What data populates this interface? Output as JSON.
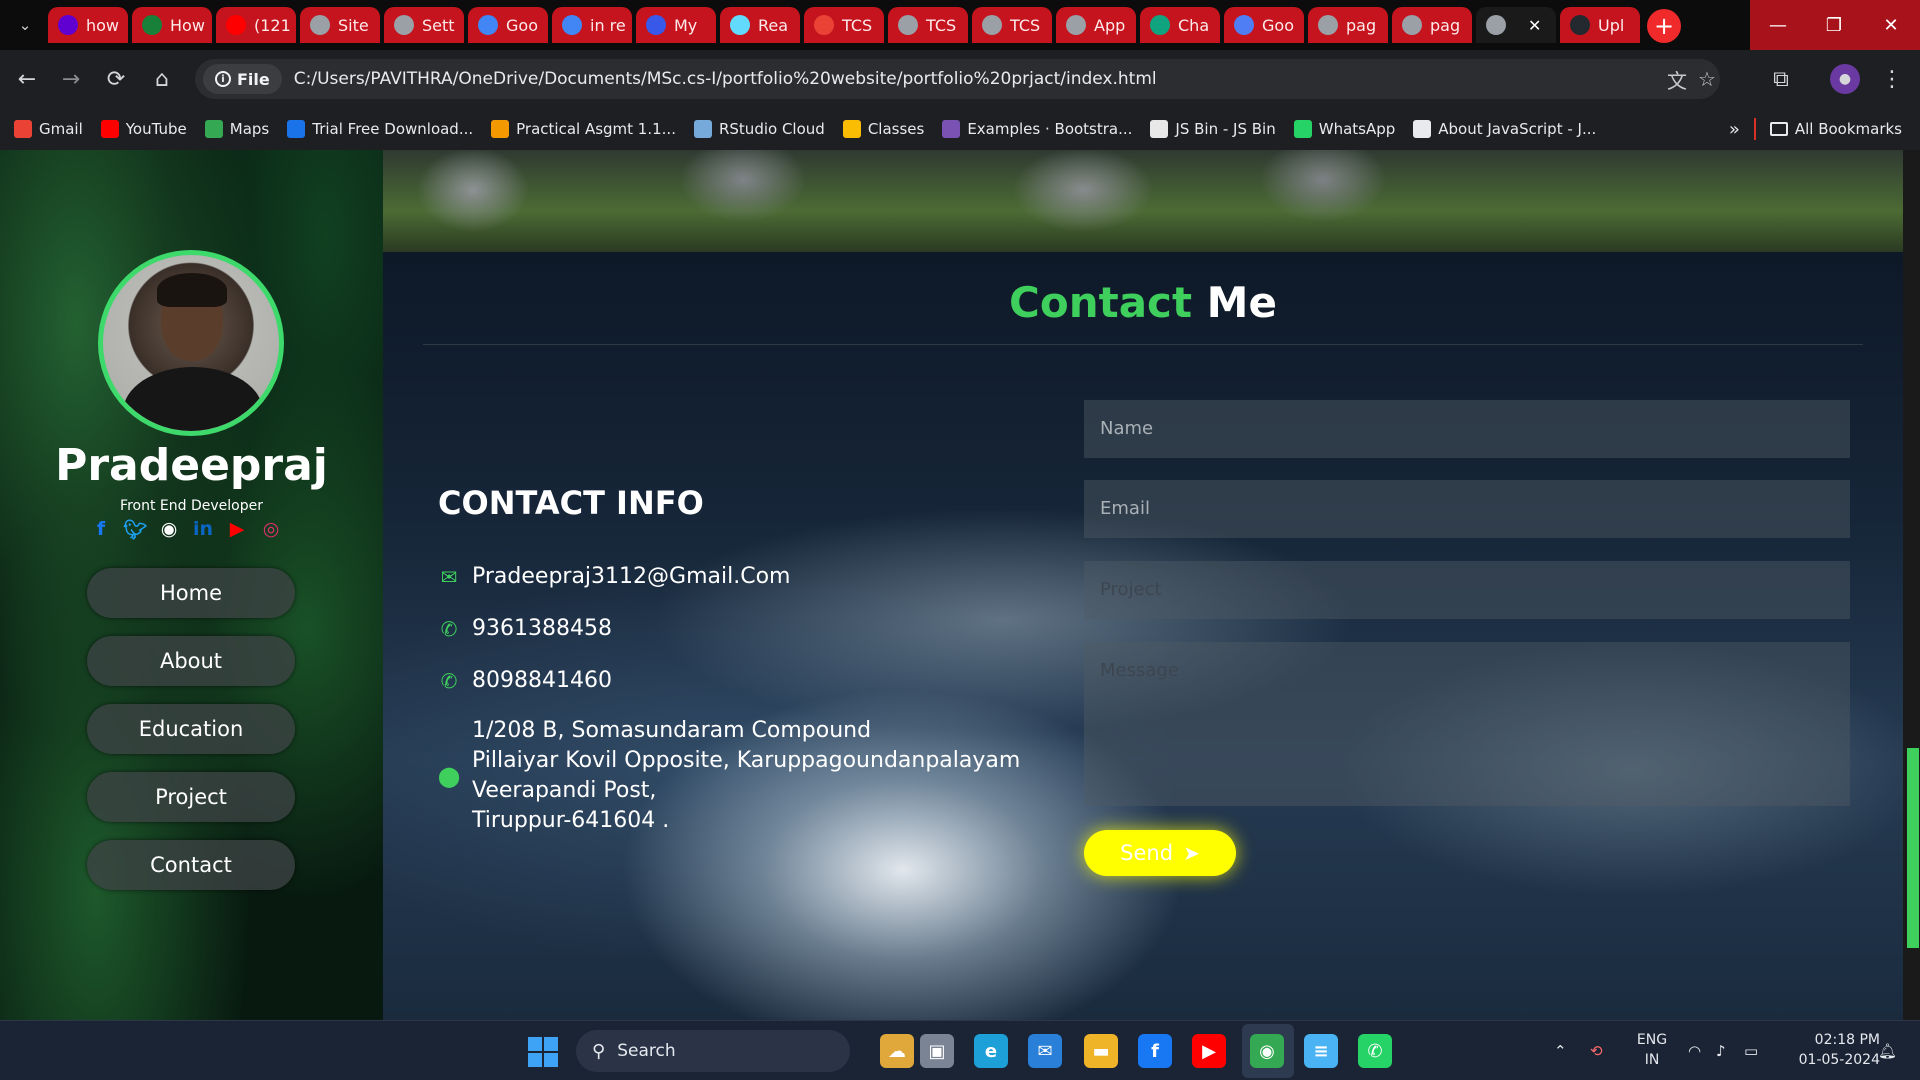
{
  "browser": {
    "tabs": [
      {
        "label": "how",
        "icon": "yahoo-icon",
        "color": "#6001d2"
      },
      {
        "label": "How",
        "icon": "sheets-icon",
        "color": "#188038"
      },
      {
        "label": "(121",
        "icon": "youtube-icon",
        "color": "#ff0000"
      },
      {
        "label": "Site",
        "icon": "globe-icon",
        "color": "#9aa0a6"
      },
      {
        "label": "Sett",
        "icon": "gear-icon",
        "color": "#9aa0a6"
      },
      {
        "label": "Goo",
        "icon": "google-icon",
        "color": "#4285f4"
      },
      {
        "label": "in re",
        "icon": "google-icon",
        "color": "#4285f4"
      },
      {
        "label": "My",
        "icon": "wordpress-icon",
        "color": "#3858e9"
      },
      {
        "label": "Rea",
        "icon": "react-icon",
        "color": "#61dafb"
      },
      {
        "label": "TCS",
        "icon": "gmail-icon",
        "color": "#ea4335"
      },
      {
        "label": "TCS",
        "icon": "globe-icon",
        "color": "#9aa0a6"
      },
      {
        "label": "TCS",
        "icon": "globe-icon",
        "color": "#9aa0a6"
      },
      {
        "label": "App",
        "icon": "globe-icon",
        "color": "#9aa0a6"
      },
      {
        "label": "Cha",
        "icon": "chatgpt-icon",
        "color": "#10a37f"
      },
      {
        "label": "Goo",
        "icon": "gemini-icon",
        "color": "#4f7df3"
      },
      {
        "label": "pag",
        "icon": "globe-icon",
        "color": "#9aa0a6"
      },
      {
        "label": "pag",
        "icon": "globe-icon",
        "color": "#9aa0a6"
      },
      {
        "label": "",
        "icon": "globe-icon",
        "color": "#9aa0a6",
        "active": true
      },
      {
        "label": "Upl",
        "icon": "github-icon",
        "color": "#24292f"
      }
    ],
    "address": {
      "scheme_label": "File",
      "url": "C:/Users/PAVITHRA/OneDrive/Documents/MSc.cs-I/portfolio%20website/portfolio%20prjact/index.html"
    },
    "bookmarks": [
      {
        "label": "Gmail",
        "icon": "gmail-icon",
        "color": "#ea4335"
      },
      {
        "label": "YouTube",
        "icon": "youtube-icon",
        "color": "#ff0000"
      },
      {
        "label": "Maps",
        "icon": "maps-icon",
        "color": "#34a853"
      },
      {
        "label": "Trial Free Download...",
        "icon": "link-icon",
        "color": "#1a73e8"
      },
      {
        "label": "Practical Asgmt 1.1...",
        "icon": "course-icon",
        "color": "#f29900"
      },
      {
        "label": "RStudio Cloud",
        "icon": "rstudio-icon",
        "color": "#75aadb"
      },
      {
        "label": "Classes",
        "icon": "classroom-icon",
        "color": "#fbbc04"
      },
      {
        "label": "Examples · Bootstra...",
        "icon": "bootstrap-icon",
        "color": "#7952b3"
      },
      {
        "label": "JS Bin - JS Bin",
        "icon": "jsbin-icon",
        "color": "#e8e8e8"
      },
      {
        "label": "WhatsApp",
        "icon": "whatsapp-icon",
        "color": "#25d366"
      },
      {
        "label": "About JavaScript - J...",
        "icon": "mdn-icon",
        "color": "#e8eaed"
      }
    ],
    "all_bookmarks_label": "All Bookmarks"
  },
  "profile": {
    "name": "Pradeepraj",
    "role": "Front End Developer",
    "socials": [
      {
        "icon": "facebook-icon",
        "color": "#1877f2"
      },
      {
        "icon": "twitter-icon",
        "color": "#1da1f2"
      },
      {
        "icon": "github-icon",
        "color": "#ffffff"
      },
      {
        "icon": "linkedin-icon",
        "color": "#0a66c2"
      },
      {
        "icon": "youtube-icon",
        "color": "#ff0000"
      },
      {
        "icon": "instagram-icon",
        "color": "#e1306c"
      }
    ]
  },
  "nav": [
    "Home",
    "About",
    "Education",
    "Project",
    "Contact"
  ],
  "contact": {
    "title_accent": "Contact",
    "title_rest": "Me",
    "info_heading": "CONTACT INFO",
    "email": "Pradeepraj3112@Gmail.Com",
    "phones": [
      "9361388458",
      "8098841460"
    ],
    "address_lines": [
      "1/208 B, Somasundaram Compound",
      "Pillaiyar Kovil Opposite, Karuppagoundanpalayam",
      "Veerapandi Post,",
      "Tiruppur-641604 ."
    ],
    "form": {
      "name_placeholder": "Name",
      "email_placeholder": "Email",
      "project_placeholder": "Project",
      "message_placeholder": "Message",
      "send_label": "Send"
    },
    "accent_color": "#3ecf5c",
    "button_color": "#ffff00"
  },
  "taskbar": {
    "search_label": "Search",
    "apps": [
      "widgets-icon",
      "task-view-icon",
      "edge-icon",
      "mail-icon",
      "file-explorer-icon",
      "facebook-icon",
      "youtube-icon",
      "chrome-icon",
      "notepad-icon",
      "whatsapp-icon"
    ],
    "lang_top": "ENG",
    "lang_bottom": "IN",
    "time": "02:18 PM",
    "date": "01-05-2024"
  }
}
